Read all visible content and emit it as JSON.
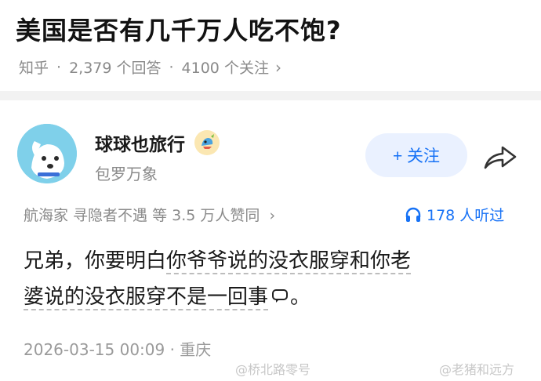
{
  "question": {
    "title": "美国是否有几千万人吃不饱?",
    "source": "知乎",
    "answers": "2,379 个回答",
    "followers": "4100 个关注",
    "sep": "·",
    "chevron": "›"
  },
  "author": {
    "name": "球球也旅行",
    "tag": "包罗万象",
    "avatar_icon": "dog-avatar-icon",
    "badge_icon": "badge-emoji-icon",
    "follow_label": "+ 关注",
    "share_icon": "share-arrow-icon"
  },
  "endorsement": {
    "text": "航海家 寻隐者不遇 等 3.5 万人赞同",
    "chevron": "›",
    "listen_count": "178 人听过",
    "listen_icon": "headphone-icon"
  },
  "answer": {
    "line1_prefix": "兄弟，你要明白",
    "line1_underlined": "你爷爷说的没衣服穿和你老",
    "line2_underlined": "婆说的没衣服穿不是一回事",
    "line2_suffix": "。"
  },
  "meta": {
    "date": "2026-03-15 00:09 · 重庆"
  },
  "watermarks": {
    "left": "@桥北路零号",
    "right": "@老猪和远方"
  },
  "colors": {
    "accent": "#1772f6",
    "muted": "#8a8a8a",
    "avatar_bg": "#7fd0ea"
  }
}
